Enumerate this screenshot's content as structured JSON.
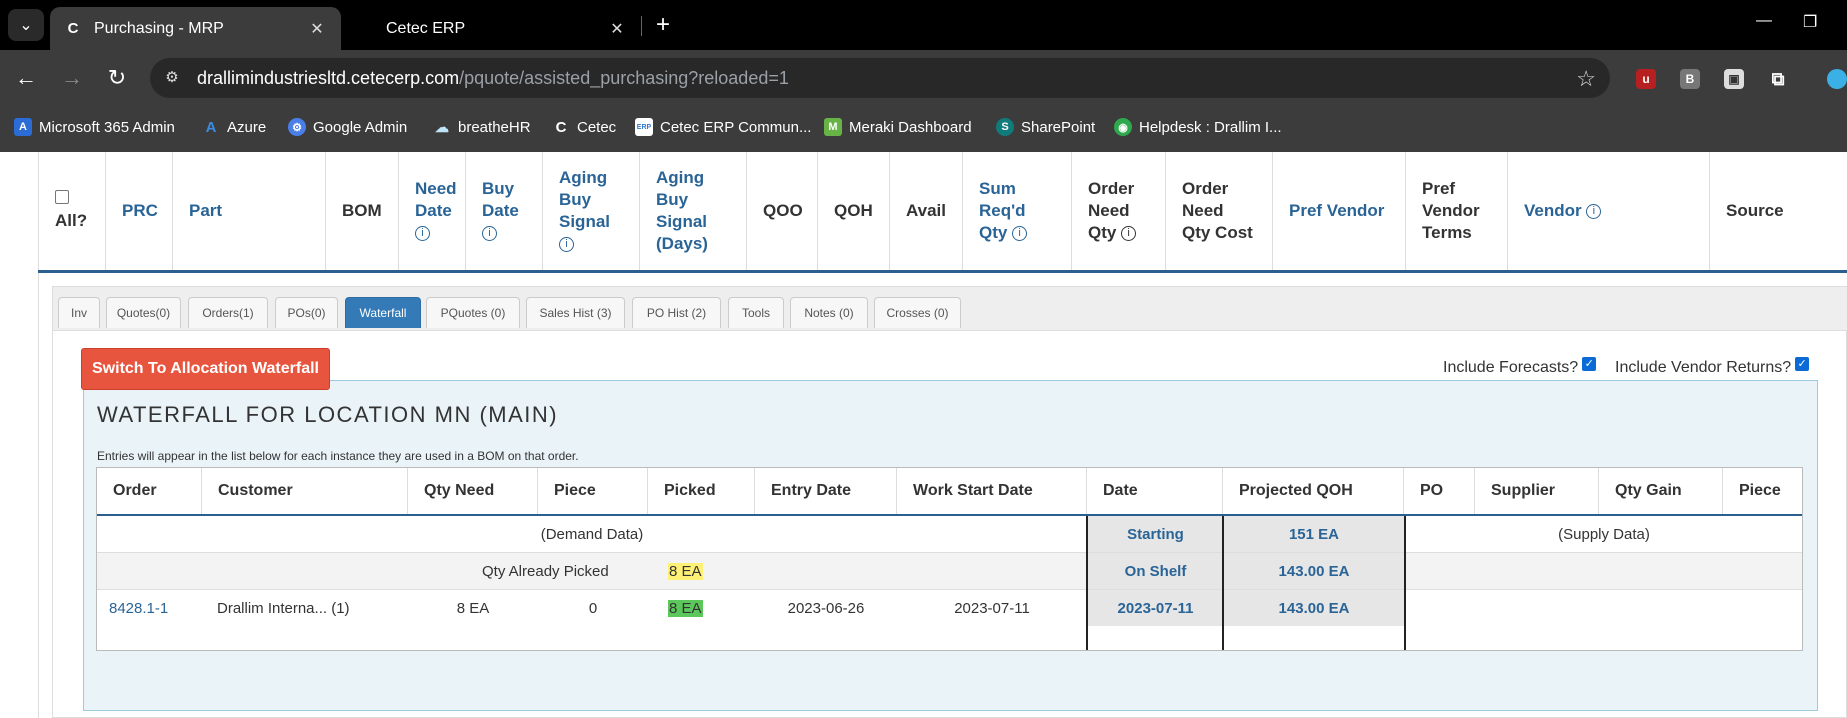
{
  "browser": {
    "tabs": [
      {
        "title": "Purchasing - MRP",
        "favicon": "C"
      },
      {
        "title": "Cetec ERP"
      }
    ],
    "url_host": "drallimindustriesltd.cetecerp.com",
    "url_path": "/pquote/assisted_purchasing?reloaded=1",
    "bookmarks": [
      {
        "label": "Microsoft 365 Admin",
        "icon": "A",
        "color": "#2b6cd6"
      },
      {
        "label": "Azure",
        "icon": "A",
        "color": "#3d8be0"
      },
      {
        "label": "Google Admin",
        "icon": "⚙",
        "color": "#4a7fe8"
      },
      {
        "label": "breatheHR",
        "icon": "☁",
        "color": "#4aa3df"
      },
      {
        "label": "Cetec",
        "icon": "C",
        "color": "#222222"
      },
      {
        "label": "Cetec ERP Commun...",
        "icon": "ERP",
        "color": "#3a78c9"
      },
      {
        "label": "Meraki Dashboard",
        "icon": "M",
        "color": "#67b346"
      },
      {
        "label": "SharePoint",
        "icon": "S",
        "color": "#0f7b7b"
      },
      {
        "label": "Helpdesk : Drallim I...",
        "icon": "◉",
        "color": "#2fa94e"
      }
    ]
  },
  "grid_header": {
    "all_label": "All?",
    "columns": {
      "prc": "PRC",
      "part": "Part",
      "bom": "BOM",
      "need_date": [
        "Need",
        "Date"
      ],
      "buy_date": [
        "Buy",
        "Date"
      ],
      "aging_buy_signal": [
        "Aging",
        "Buy",
        "Signal"
      ],
      "aging_buy_signal_days": [
        "Aging",
        "Buy",
        "Signal",
        "(Days)"
      ],
      "qoo": "QOO",
      "qoh": "QOH",
      "avail": "Avail",
      "sum_reqd_qty": [
        "Sum",
        "Req'd",
        "Qty"
      ],
      "order_need_qty": [
        "Order",
        "Need",
        "Qty"
      ],
      "order_need_qty_cost": [
        "Order",
        "Need",
        "Qty Cost"
      ],
      "pref_vendor": "Pref Vendor",
      "pref_vendor_terms": [
        "Pref",
        "Vendor",
        "Terms"
      ],
      "vendor": "Vendor",
      "source": "Source"
    }
  },
  "subtabs": [
    "Inv",
    "Quotes(0)",
    "Orders(1)",
    "POs(0)",
    "Waterfall",
    "PQuotes (0)",
    "Sales Hist (3)",
    "PO Hist (2)",
    "Tools",
    "Notes (0)",
    "Crosses (0)"
  ],
  "active_subtab": "Waterfall",
  "switch_button": "Switch To Allocation Waterfall",
  "include_forecasts": {
    "label": "Include Forecasts?",
    "checked": true
  },
  "include_vendor_returns": {
    "label": "Include Vendor Returns?",
    "checked": true
  },
  "waterfall": {
    "title": "WATERFALL FOR LOCATION MN (MAIN)",
    "note": "Entries will appear in the list below for each instance they are used in a BOM on that order.",
    "columns": [
      "Order",
      "Customer",
      "Qty Need",
      "Piece",
      "Picked",
      "Entry Date",
      "Work Start Date",
      "Date",
      "Projected QOH",
      "PO",
      "Supplier",
      "Qty Gain",
      "Piece"
    ],
    "demand_label": "(Demand Data)",
    "supply_label": "(Supply Data)",
    "starting_label": "Starting",
    "starting_qoh": "151 EA",
    "already_picked_label": "Qty Already Picked",
    "already_picked_value": "8 EA",
    "on_shelf_label": "On Shelf",
    "on_shelf_qoh": "143.00 EA",
    "rows": [
      {
        "order": "8428.1-1",
        "customer": "Drallim Interna... (1)",
        "qty_need": "8 EA",
        "piece": "0",
        "picked": "8 EA",
        "entry_date": "2023-06-26",
        "work_start_date": "2023-07-11",
        "date": "2023-07-11",
        "projected_qoh": "143.00 EA"
      }
    ]
  }
}
